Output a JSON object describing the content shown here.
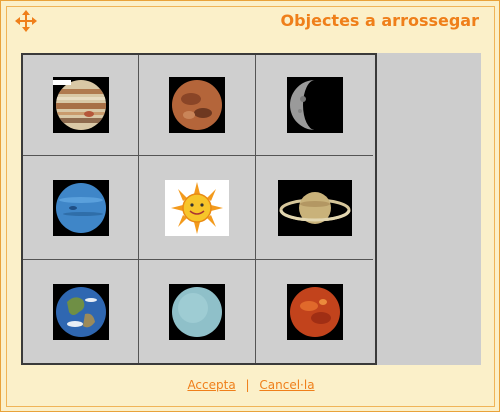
{
  "dialog": {
    "title": "Objectes a arrossegar",
    "accept_label": " Accepta",
    "separator": "|",
    "cancel_label": " Cancel·la"
  },
  "grid": {
    "rows": [
      [
        {
          "name": "jupiter"
        },
        {
          "name": "mars"
        },
        {
          "name": "moon"
        }
      ],
      [
        {
          "name": "neptune"
        },
        {
          "name": "sun"
        },
        {
          "name": "saturn"
        }
      ],
      [
        {
          "name": "earth"
        },
        {
          "name": "uranus"
        },
        {
          "name": "venus"
        }
      ]
    ]
  },
  "colors": {
    "accent": "#ef7f1a",
    "background": "#fbf0c9",
    "board": "#cdcdcd"
  }
}
